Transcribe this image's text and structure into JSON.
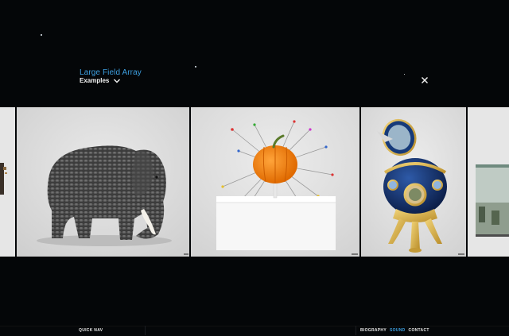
{
  "header": {
    "title": "Large Field Array",
    "subtitle": "Examples"
  },
  "icons": {
    "dropdown": "chevron-down-icon",
    "close": "close-icon"
  },
  "gallery": {
    "items": [
      {
        "subject": "partial-artwork-left"
      },
      {
        "subject": "elephant-sculpture"
      },
      {
        "subject": "pumpkin-with-pins-on-pedestal"
      },
      {
        "subject": "jeweled-egg"
      },
      {
        "subject": "aquarium-partial"
      }
    ]
  },
  "footer": {
    "quick_nav": "QUICK NAV",
    "links": [
      {
        "label": "BIOGRAPHY",
        "active": false
      },
      {
        "label": "SOUND",
        "active": true
      },
      {
        "label": "CONTACT",
        "active": false
      }
    ]
  },
  "colors": {
    "background": "#040608",
    "accent": "#3d9fe0",
    "text": "#f2f2f2"
  }
}
